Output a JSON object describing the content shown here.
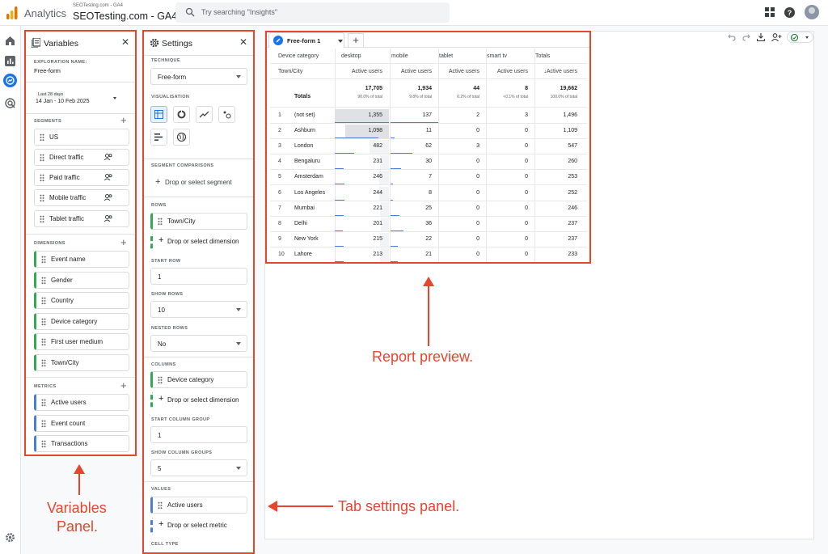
{
  "topbar": {
    "app_name": "Analytics",
    "account_sub": "SEOTesting.com - GA4",
    "account_name": "SEOTesting.com - GA4",
    "search_placeholder": "Try searching \"Insights\""
  },
  "variables": {
    "title": "Variables",
    "exploration_label": "EXPLORATION NAME:",
    "exploration_name": "Free-form",
    "date_label": "Last 28 days",
    "date_range": "14 Jan - 10 Feb 2025",
    "segments_label": "SEGMENTS",
    "segments": [
      "US",
      "Direct traffic",
      "Paid traffic",
      "Mobile traffic",
      "Tablet traffic"
    ],
    "dimensions_label": "DIMENSIONS",
    "dimensions": [
      "Event name",
      "Gender",
      "Country",
      "Device category",
      "First user medium",
      "Town/City"
    ],
    "metrics_label": "METRICS",
    "metrics": [
      "Active users",
      "Event count",
      "Transactions"
    ]
  },
  "settings": {
    "title": "Settings",
    "technique_label": "TECHNIQUE",
    "technique": "Free-form",
    "visualisation_label": "VISUALISATION",
    "seg_comp_label": "SEGMENT COMPARISONS",
    "seg_drop": "Drop or select segment",
    "rows_label": "ROWS",
    "row_item": "Town/City",
    "dim_drop": "Drop or select dimension",
    "start_row_label": "START ROW",
    "start_row": "1",
    "show_rows_label": "SHOW ROWS",
    "show_rows": "10",
    "nested_label": "NESTED ROWS",
    "nested": "No",
    "columns_label": "COLUMNS",
    "col_item": "Device category",
    "col_drop": "Drop or select dimension",
    "start_col_label": "START COLUMN GROUP",
    "start_col": "1",
    "show_col_label": "SHOW COLUMN GROUPS",
    "show_col": "5",
    "values_label": "VALUES",
    "value_item": "Active users",
    "metric_drop": "Drop or select metric",
    "cell_type_label": "CELL TYPE"
  },
  "report": {
    "tab_name": "Free-form 1",
    "header_dim": "Device category",
    "row_dim": "Town/City",
    "columns": [
      "desktop",
      "mobile",
      "tablet",
      "smart tv",
      "Totals"
    ],
    "metric_headers": [
      "Active users",
      "Active users",
      "Active users",
      "Active users",
      "↓Active users"
    ],
    "totals_label": "Totals",
    "totals": [
      "17,705",
      "1,934",
      "44",
      "8",
      "19,662"
    ],
    "totals_pct": [
      "90.0% of total",
      "9.8% of total",
      "0.2% of total",
      "<0.1% of total",
      "100.0% of total"
    ],
    "rows": [
      {
        "n": "1",
        "city": "(not set)",
        "vals": [
          "1,355",
          "137",
          "2",
          "3",
          "1,496"
        ]
      },
      {
        "n": "2",
        "city": "Ashburn",
        "vals": [
          "1,098",
          "11",
          "0",
          "0",
          "1,109"
        ]
      },
      {
        "n": "3",
        "city": "London",
        "vals": [
          "482",
          "62",
          "3",
          "0",
          "547"
        ]
      },
      {
        "n": "4",
        "city": "Bengaluru",
        "vals": [
          "231",
          "30",
          "0",
          "0",
          "260"
        ]
      },
      {
        "n": "5",
        "city": "Amsterdam",
        "vals": [
          "246",
          "7",
          "0",
          "0",
          "253"
        ]
      },
      {
        "n": "6",
        "city": "Los Angeles",
        "vals": [
          "244",
          "8",
          "0",
          "0",
          "252"
        ]
      },
      {
        "n": "7",
        "city": "Mumbai",
        "vals": [
          "221",
          "25",
          "0",
          "0",
          "246"
        ]
      },
      {
        "n": "8",
        "city": "Delhi",
        "vals": [
          "201",
          "36",
          "0",
          "0",
          "237"
        ]
      },
      {
        "n": "9",
        "city": "New York",
        "vals": [
          "215",
          "22",
          "0",
          "0",
          "237"
        ]
      },
      {
        "n": "10",
        "city": "Lahore",
        "vals": [
          "213",
          "21",
          "0",
          "0",
          "233"
        ]
      }
    ]
  },
  "annotations": {
    "report": "Report preview.",
    "variables_l1": "Variables",
    "variables_l2": "Panel.",
    "settings": "Tab settings panel."
  },
  "colors": {
    "accent": "#1a73e8",
    "annotation": "#e8452d",
    "dimension": "#34a853",
    "metric": "#4a7fd8"
  },
  "icons": [
    "analytics-logo-icon",
    "search-icon",
    "apps-grid-icon",
    "help-icon",
    "home-icon",
    "reports-icon",
    "explore-icon",
    "advertising-icon",
    "admin-gear-icon",
    "undo-icon",
    "redo-icon",
    "download-icon",
    "share-user-icon",
    "check-circle-icon"
  ]
}
